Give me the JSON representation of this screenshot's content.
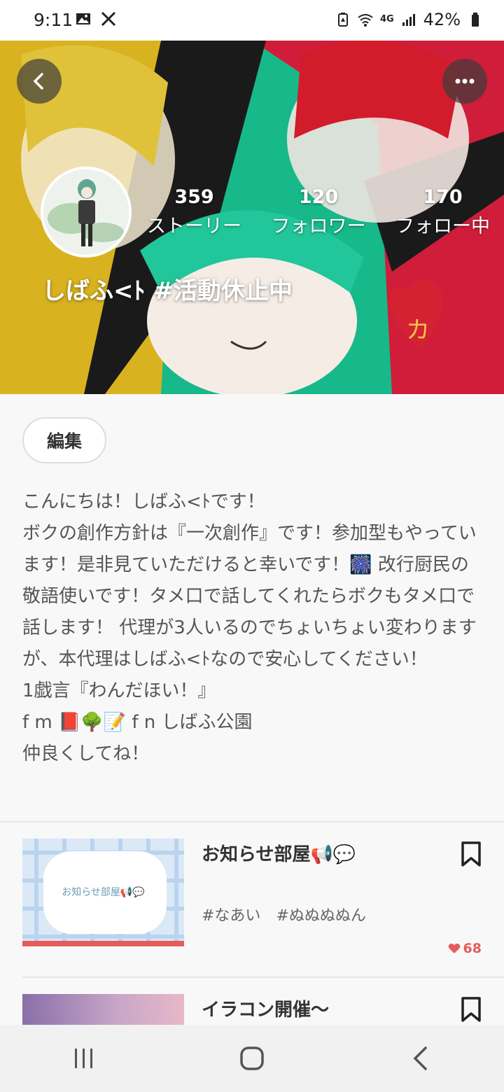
{
  "status_bar": {
    "time": "9:11",
    "network": "4G",
    "battery": "42%"
  },
  "header": {
    "stats": [
      {
        "value": "359",
        "label": "ストーリー"
      },
      {
        "value": "120",
        "label": "フォロワー"
      },
      {
        "value": "170",
        "label": "フォロー中"
      }
    ],
    "username": "しばふ<ﾄ #活動休止中"
  },
  "profile": {
    "edit_label": "編集",
    "bio_lines": [
      "こんにちは！しばふ<ﾄです！",
      "ボクの創作方針は『一次創作』です！参加型もやっています！是非見ていただけると幸いです！🎆 改行厨民の敬語使いです！タメ口で話してくれたらボクもタメ口で話します！ 代理が3人いるのでちょいちょい変わりますが、本代理はしばふ<ﾄなので安心してください！",
      "1戯言『わんだほい！』",
      "f m 📕🌳📝 f n しばふ公園",
      "仲良くしてね！"
    ]
  },
  "posts": [
    {
      "title": "お知らせ部屋📢💬",
      "thumb_text": "お知らせ部屋📢💬",
      "tags": [
        "#なあい",
        "#ぬぬぬぬん"
      ],
      "likes": "68"
    },
    {
      "title": "イラコン開催〜"
    }
  ],
  "colors": {
    "accent": "#e65c5c"
  },
  "icons": {
    "back": "chevron-left-icon",
    "more": "more-horizontal-icon",
    "bookmark": "bookmark-icon",
    "heart": "heart-icon"
  }
}
